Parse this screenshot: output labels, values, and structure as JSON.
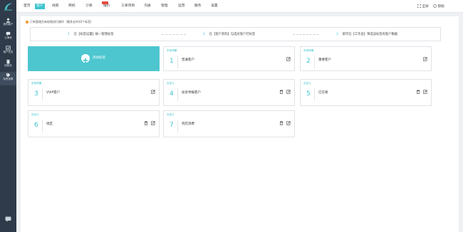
{
  "sidebar": {
    "items": [
      {
        "label": "我的客户",
        "icon": "user-icon"
      },
      {
        "label": "公海池",
        "icon": "chat-icon"
      },
      {
        "label": "客户总览",
        "icon": "chart-icon"
      },
      {
        "label": "回收站",
        "icon": "trash-icon"
      },
      {
        "label": "标签设置",
        "icon": "tag-icon"
      }
    ],
    "active_index": 4,
    "bottom_icon": "message-icon"
  },
  "topnav": {
    "items": [
      "首页",
      "客户",
      "线索",
      "商机",
      "订单",
      "报价",
      "工单项目",
      "沟通",
      "管理",
      "运营",
      "服务",
      "设置"
    ],
    "active_index": 1,
    "right": {
      "fullscreen_label": "全屏",
      "help_label": "帮助"
    }
  },
  "tip": "只有管理员有权限进行操作（最多支持10个标签）",
  "steps": [
    {
      "num": "1",
      "text": "在【标签设置】统一管理标签"
    },
    {
      "num": "2",
      "text": "在【客户资料】勾选对客户打标签"
    },
    {
      "num": "3",
      "text": "即可在【工作台】筛选该标签的客户数据"
    }
  ],
  "add_card": {
    "label": "添加标签"
  },
  "cards": [
    {
      "tag": "系统预置",
      "num": "1",
      "name": "普通客户",
      "deletable": false
    },
    {
      "tag": "系统预置",
      "num": "2",
      "name": "重要客户",
      "deletable": false
    },
    {
      "tag": "系统预置",
      "num": "3",
      "name": "VVIP客户",
      "deletable": false
    },
    {
      "tag": "自定义",
      "num": "4",
      "name": "投诉举报客户",
      "deletable": true
    },
    {
      "tag": "自定义",
      "num": "5",
      "name": "已交易",
      "deletable": true
    },
    {
      "tag": "自定义",
      "num": "6",
      "name": "地区",
      "deletable": true
    },
    {
      "tag": "自定义",
      "num": "7",
      "name": "到店消费",
      "deletable": true
    }
  ],
  "colors": {
    "accent": "#3ec4ce",
    "sidebar": "#2f3b4a",
    "badge": "#e8483d"
  }
}
